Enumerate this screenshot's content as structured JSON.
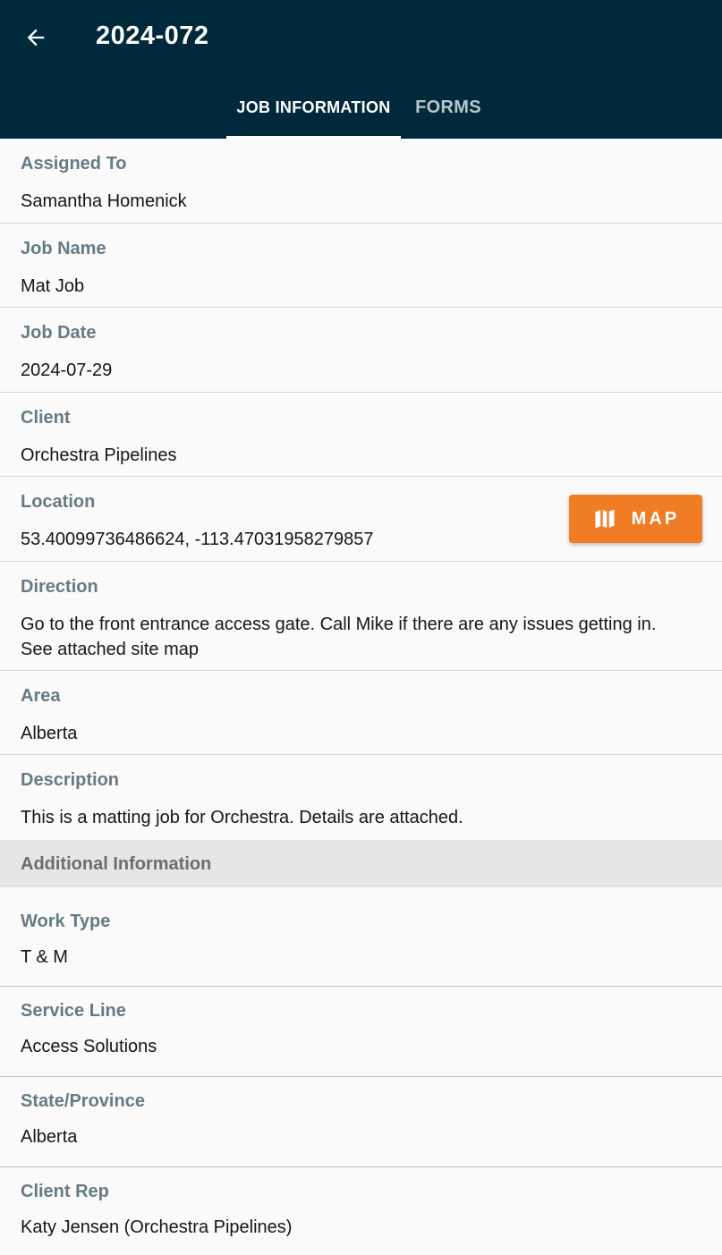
{
  "header": {
    "title": "2024-072",
    "back_icon": "arrow-left-icon",
    "tabs": [
      {
        "label": "JOB INFORMATION",
        "active": true
      },
      {
        "label": "FORMS",
        "active": false
      }
    ]
  },
  "job": {
    "assigned_to": {
      "label": "Assigned To",
      "value": "Samantha Homenick"
    },
    "job_name": {
      "label": "Job Name",
      "value": "Mat Job"
    },
    "job_date": {
      "label": "Job Date",
      "value": "2024-07-29"
    },
    "client": {
      "label": "Client",
      "value": "Orchestra Pipelines"
    },
    "location": {
      "label": "Location",
      "value": "53.40099736486624, -113.47031958279857",
      "map_button": "MAP",
      "map_icon": "map-icon"
    },
    "direction": {
      "label": "Direction",
      "line1": "Go to the front entrance access gate.  Call Mike if there are any issues getting in.",
      "line2": "See attached site map"
    },
    "area": {
      "label": "Area",
      "value": "Alberta"
    },
    "description": {
      "label": "Description",
      "value": "This is a matting job for Orchestra. Details are attached."
    }
  },
  "additional": {
    "section_title": "Additional Information",
    "work_type": {
      "label": "Work Type",
      "value": "T & M"
    },
    "service_line": {
      "label": "Service Line",
      "value": "Access Solutions"
    },
    "state_province": {
      "label": "State/Province",
      "value": "Alberta"
    },
    "client_rep": {
      "label": "Client Rep",
      "value": "Katy Jensen (Orchestra Pipelines)"
    }
  },
  "colors": {
    "header_bg": "#002a3b",
    "accent": "#f07d25",
    "label": "#667a86"
  }
}
